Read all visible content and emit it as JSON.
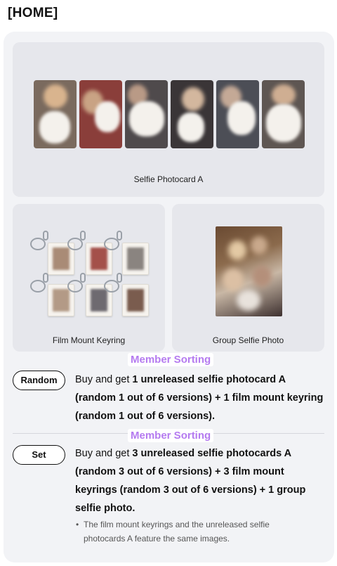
{
  "page_title": "[HOME]",
  "products": {
    "photocard": {
      "caption": "Selfie Photocard A"
    },
    "keyring": {
      "caption": "Film Mount Keyring"
    },
    "group_photo": {
      "caption": "Group Selfie Photo"
    }
  },
  "options": [
    {
      "badge": "Member Sorting",
      "label": "Random",
      "text_prefix": "Buy and get ",
      "text_bold": "1 unreleased selfie photocard A (random 1 out of 6 versions) + 1 film mount keyring (random 1 out of 6 versions)."
    },
    {
      "badge": "Member Sorting",
      "label": "Set",
      "text_prefix": "Buy and get ",
      "text_bold": "3 unreleased selfie photocards A (random 3 out of 6 versions) + 3 film mount keyrings (random 3 out of 6 versions) + 1 group selfie photo."
    }
  ],
  "note": "The film mount keyrings and the unreleased selfie photocards A feature the same images.",
  "colors": {
    "badge_text": "#b57bf0",
    "panel_bg": "#f2f3f6",
    "card_bg": "#e6e7ec"
  }
}
